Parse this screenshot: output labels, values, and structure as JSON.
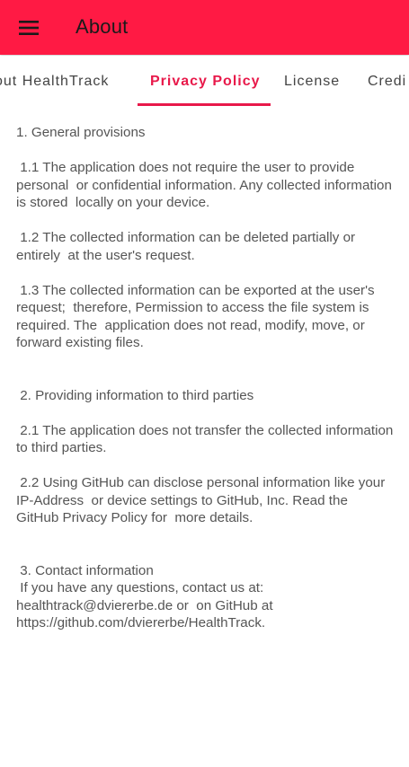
{
  "appbar": {
    "title": "About",
    "menu_icon": "hamburger-menu-icon",
    "color": "#ff1a44"
  },
  "tabs": [
    {
      "label": "About HealthTrack",
      "shown": "out HealthTrack",
      "active": false
    },
    {
      "label": "Privacy Policy",
      "shown": "Privacy Policy",
      "active": true
    },
    {
      "label": "License",
      "shown": "License",
      "active": false
    },
    {
      "label": "Credits",
      "shown": "Credi",
      "active": false
    }
  ],
  "accent_color": "#e8194a",
  "policy": {
    "text": "1. General provisions\n\n 1.1 The application does not require the user to provide personal  or confidential information. Any collected information is stored  locally on your device.\n\n 1.2 The collected information can be deleted partially or entirely  at the user's request.\n\n 1.3 The collected information can be exported at the user's request;  therefore, Permission to access the file system is required. The  application does not read, modify, move, or forward existing files.\n\n\n 2. Providing information to third parties\n\n 2.1 The application does not transfer the collected information to third parties.\n\n 2.2 Using GitHub can disclose personal information like your IP-Address  or device settings to GitHub, Inc. Read the GitHub Privacy Policy for  more details.\n\n\n 3. Contact information\n If you have any questions, contact us at: healthtrack@dviererbe.de or  on GitHub at https://github.com/dviererbe/HealthTrack."
  }
}
